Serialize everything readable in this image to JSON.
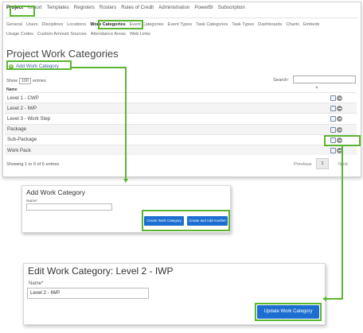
{
  "nav": {
    "main": [
      "Project",
      "Import",
      "Templates",
      "Registers",
      "Rosters",
      "Rules of Credit",
      "Administration",
      "PowerBI",
      "Subscription"
    ],
    "sub_row1": [
      "General",
      "Users",
      "Disciplines",
      "Locations",
      "Work Categories",
      "Event Categories",
      "Event Types",
      "Task Categories",
      "Task Types",
      "Dashboards",
      "Charts",
      "Embeds"
    ],
    "sub_row2": [
      "Usage Codes",
      "Custom Amount Sources",
      "Attendance Areas",
      "Web Links"
    ]
  },
  "page": {
    "title": "Project Work Categories",
    "add_link": "Add Work Category",
    "show_prefix": "Show",
    "show_value": "100",
    "show_suffix": "entries",
    "search_label": "Search:",
    "column_header": "Name",
    "rows": [
      "Level 1 - CWP",
      "Level 2 - IWP",
      "Level 3 - Work Step",
      "Package",
      "Sub-Package",
      "Work Pack"
    ],
    "showing": "Showing 1 to 6 of 6 entries",
    "previous": "Previous",
    "page_number": "1",
    "next": "Next"
  },
  "add_dialog": {
    "title": "Add Work Category",
    "name_label": "Name*",
    "name_value": "",
    "create_button": "Create Work Category",
    "create_add_button": "Create and Add Another"
  },
  "edit_dialog": {
    "title": "Edit Work Category: Level 2 - IWP",
    "name_label": "Name*",
    "name_value": "Level 2 - IWP",
    "update_button": "Update Work Category"
  },
  "colors": {
    "highlight": "#5cb531",
    "primary_button": "#1c6fd1",
    "link": "#2f5f9e"
  },
  "icons": [
    "plus-circle-icon",
    "sort-icon",
    "edit-icon",
    "delete-icon"
  ]
}
